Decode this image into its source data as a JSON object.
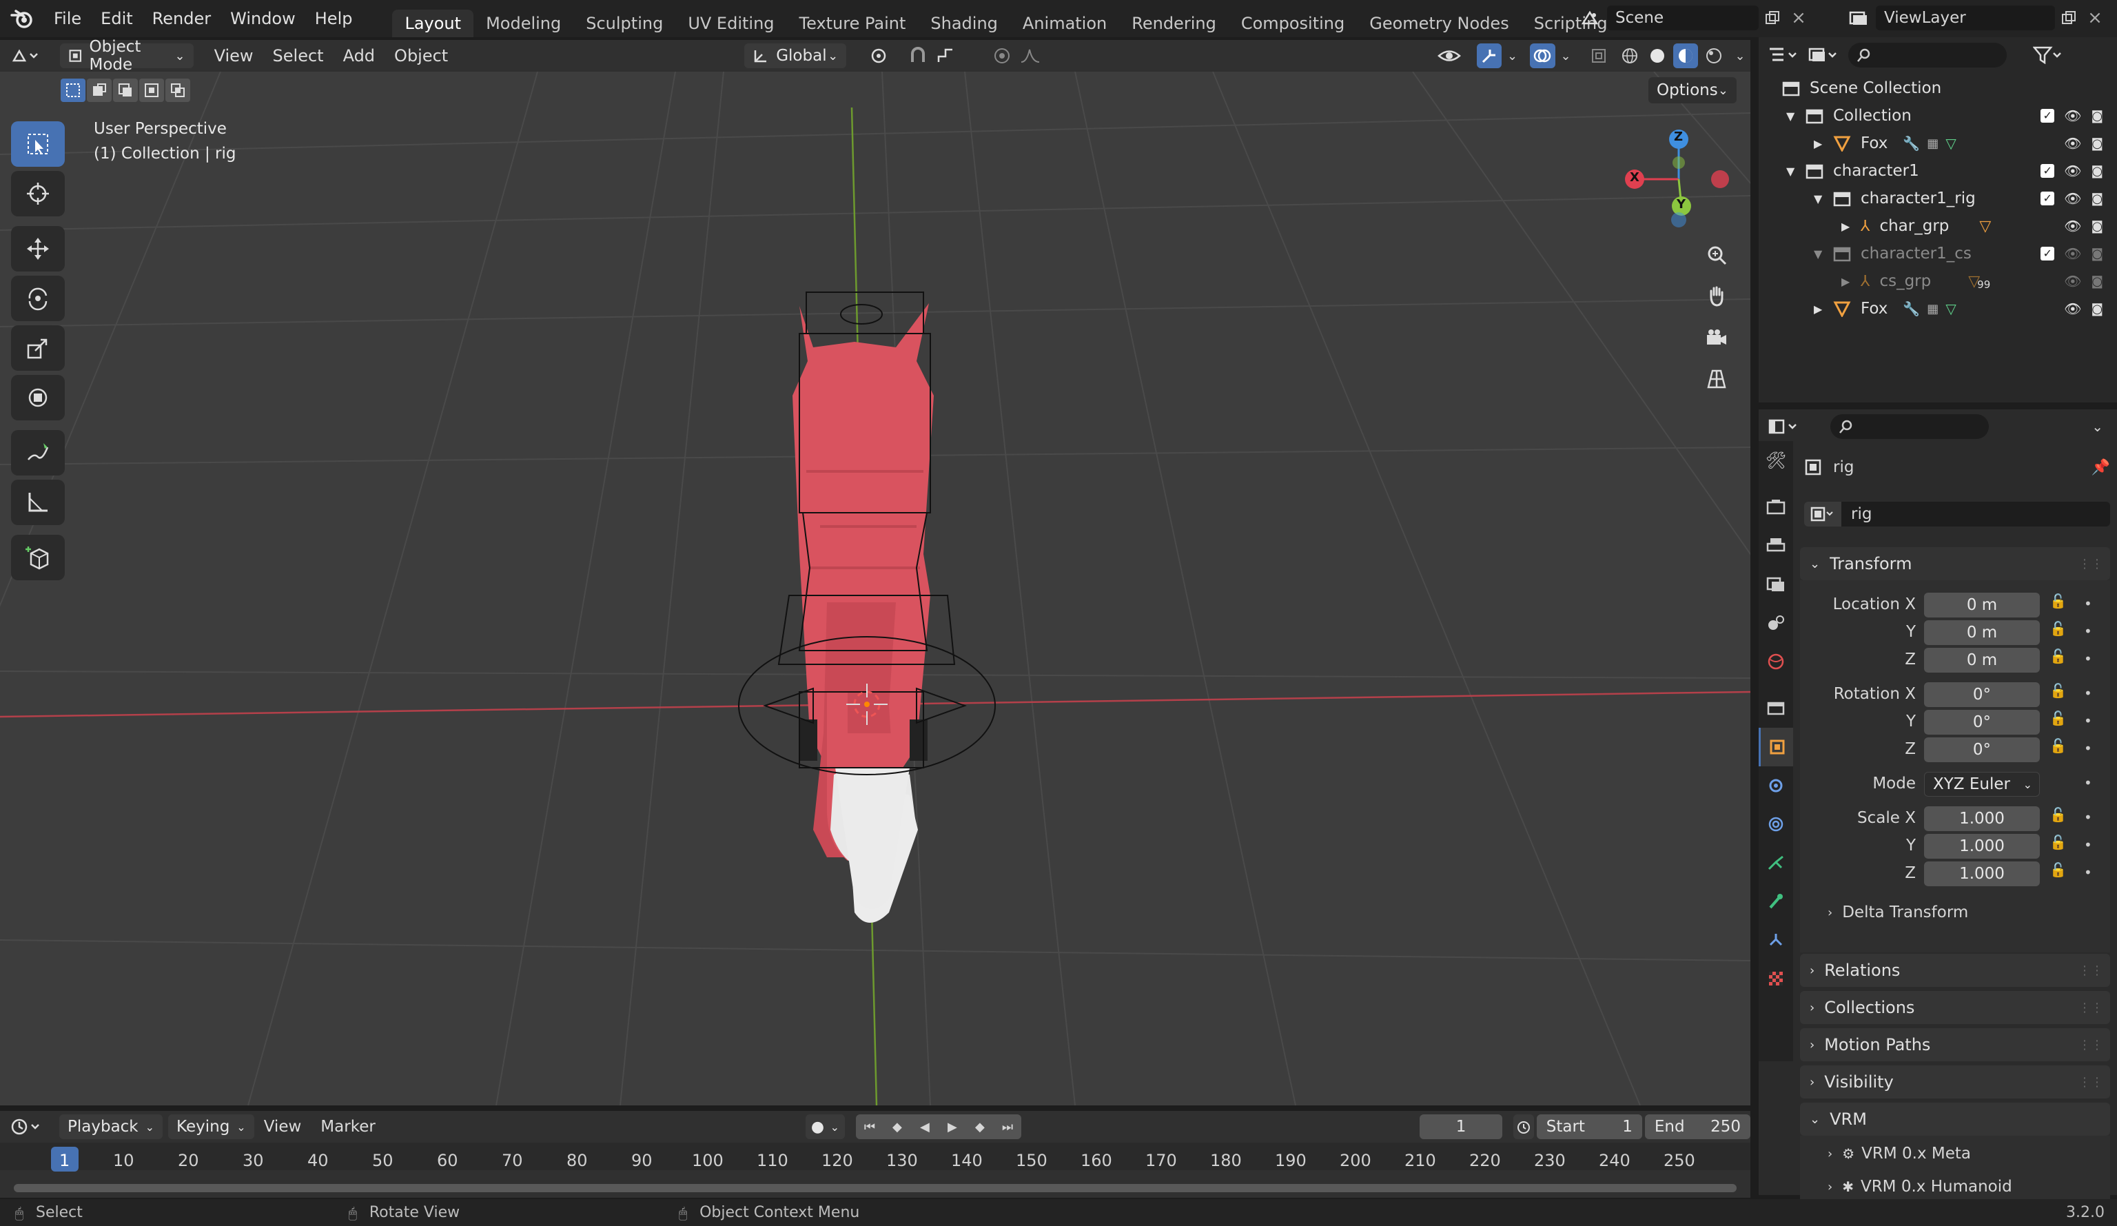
{
  "menu": {
    "file": "File",
    "edit": "Edit",
    "render": "Render",
    "window": "Window",
    "help": "Help"
  },
  "workspaces": [
    "Layout",
    "Modeling",
    "Sculpting",
    "UV Editing",
    "Texture Paint",
    "Shading",
    "Animation",
    "Rendering",
    "Compositing",
    "Geometry Nodes",
    "Scripting"
  ],
  "active_workspace": "Layout",
  "scene": {
    "scene_name": "Scene",
    "view_layer": "ViewLayer"
  },
  "viewport_header": {
    "mode": "Object Mode",
    "view": "View",
    "select": "Select",
    "add": "Add",
    "object": "Object",
    "orientation": "Global",
    "options": "Options"
  },
  "viewport": {
    "perspective_label": "User Perspective",
    "collection_label": "(1) Collection | rig"
  },
  "gizmo": {
    "x": "X",
    "y": "Y",
    "z": "Z"
  },
  "outliner": {
    "root": "Scene Collection",
    "rows": [
      {
        "label": "Collection"
      },
      {
        "label": "Fox"
      },
      {
        "label": "character1"
      },
      {
        "label": "character1_rig"
      },
      {
        "label": "char_grp"
      },
      {
        "label": "character1_cs"
      },
      {
        "label": "cs_grp"
      },
      {
        "label": "Fox"
      }
    ],
    "badge": "99"
  },
  "properties": {
    "object_name": "rig",
    "datablock_name": "rig",
    "transform": {
      "title": "Transform",
      "location_label": "Location X",
      "location": [
        "0 m",
        "0 m",
        "0 m"
      ],
      "rotation_label": "Rotation X",
      "rotation": [
        "0°",
        "0°",
        "0°"
      ],
      "mode_label": "Mode",
      "mode": "XYZ Euler",
      "scale_label": "Scale X",
      "scale": [
        "1.000",
        "1.000",
        "1.000"
      ],
      "y": "Y",
      "z": "Z",
      "delta": "Delta Transform"
    },
    "panels": [
      "Relations",
      "Collections",
      "Motion Paths",
      "Visibility"
    ],
    "vrm": {
      "title": "VRM",
      "meta": "VRM 0.x Meta",
      "humanoid": "VRM 0.x Humanoid"
    }
  },
  "timeline": {
    "playback": "Playback",
    "keying": "Keying",
    "view": "View",
    "marker": "Marker",
    "current_frame": "1",
    "start_label": "Start",
    "start": "1",
    "end_label": "End",
    "end": "250",
    "ticks": [
      "1",
      "10",
      "20",
      "30",
      "40",
      "50",
      "60",
      "70",
      "80",
      "90",
      "100",
      "110",
      "120",
      "130",
      "140",
      "150",
      "160",
      "170",
      "180",
      "190",
      "200",
      "210",
      "220",
      "230",
      "240",
      "250"
    ]
  },
  "status": {
    "select": "Select",
    "rotate": "Rotate View",
    "context": "Object Context Menu",
    "version": "3.2.0"
  },
  "colors": {
    "accent": "#4772b3",
    "x_axis": "#e04050",
    "y_axis": "#8cc63f",
    "z_axis": "#3f8fe0",
    "fox_body": "#d9535f",
    "fox_tail_tip": "#e8e8e8"
  }
}
